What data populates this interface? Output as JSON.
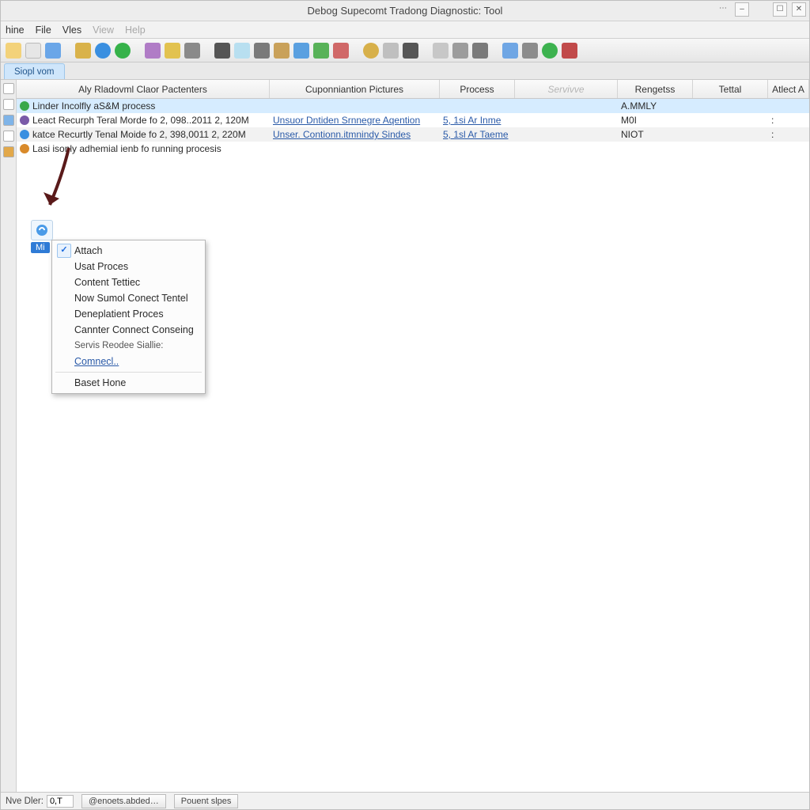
{
  "window": {
    "title": "Debog Supecomt Tradong Diagnostic: Tool"
  },
  "menu": [
    "hine",
    "File",
    "Vles",
    "View",
    "Help"
  ],
  "tabs": [
    "Siopl vom"
  ],
  "table": {
    "columns": [
      "Aly Rladovml Claor Pactenters",
      "Cuponniantion Pictures",
      "Process",
      "Servivve",
      "Rengetss",
      "Tettal",
      "Atlect A"
    ],
    "rows": [
      {
        "c0": "Linder Incolfly aS&M process",
        "c1": "",
        "c2": "",
        "c3": "",
        "c4": "A.MMLY",
        "c5": "",
        "c6": ""
      },
      {
        "c0": "Leact Recurph Teral Morde fo 2, 098..2011 2, 120M",
        "c1": "Unsuor Dntiden Srnnegre Aqention",
        "c2": "5, 1si Ar Inme",
        "c3": "",
        "c4": "M0I",
        "c5": "",
        "c6": ":"
      },
      {
        "c0": "katce Recurtly Tenal Moide fo 2, 398,0011 2, 220M",
        "c1": "Unser. Contionn.itmnindy Sindes",
        "c2": "5, 1sl Ar Taeme",
        "c3": "",
        "c4": "NIOT",
        "c5": "",
        "c6": ":"
      },
      {
        "c0": "Lasi isonly adhemial ienb fo running procesis",
        "c1": "",
        "c2": "",
        "c3": "",
        "c4": "",
        "c5": "",
        "c6": ""
      }
    ]
  },
  "chip": {
    "label": "Mi"
  },
  "context_menu": [
    "Attach",
    "Usat Proces",
    "Content Tettiec",
    "Now Sumol Conect Tentel",
    "Deneplatient Proces",
    "Cannter Connect Conseing",
    "Servis Reodee Siallie:",
    "Comnecl..",
    "Baset Hone"
  ],
  "status": {
    "label": "Nve Dler:",
    "value": "0,T",
    "btn1": "@enoets.abded…",
    "btn2": "Pouent slpes"
  }
}
